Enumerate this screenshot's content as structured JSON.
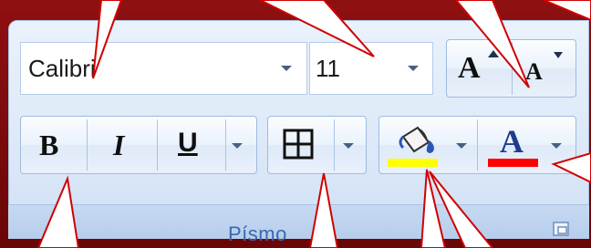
{
  "font_group": {
    "label": "Písmo",
    "font_name": "Calibri",
    "font_size": "11",
    "grow_font_glyph": "A",
    "shrink_font_glyph": "A",
    "bold_glyph": "B",
    "italic_glyph": "I",
    "underline_glyph": "U",
    "font_color_glyph": "A",
    "highlight_color": "#ffff00",
    "font_color": "#ff0000"
  },
  "icons": [
    "chevron-down-icon",
    "borders-icon",
    "paint-bucket-icon",
    "dialog-launcher-icon"
  ],
  "accent": {
    "frame": "#7a0a0a",
    "callout": "#d00000",
    "label": "#3a6ab0"
  }
}
